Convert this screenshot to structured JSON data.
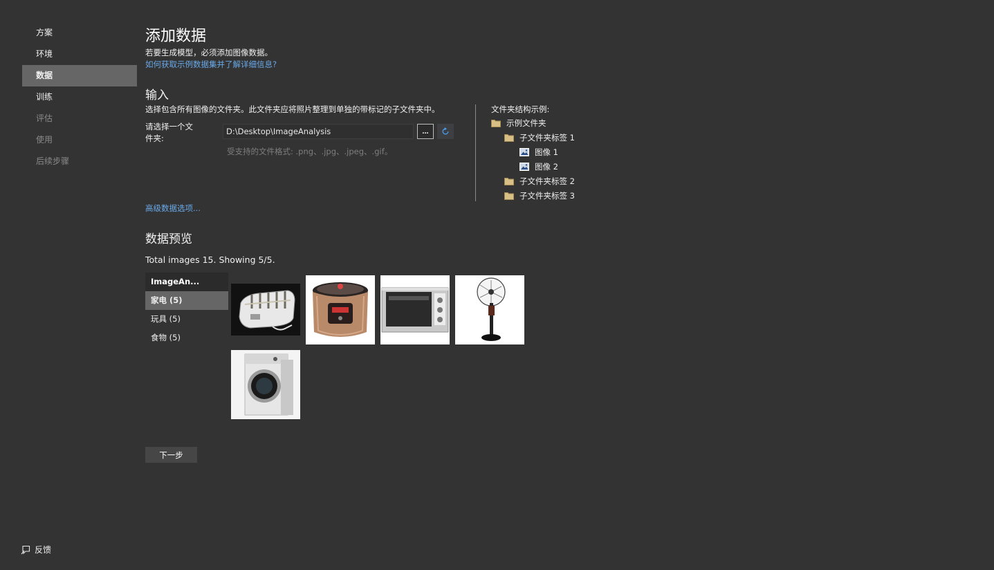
{
  "sidebar": {
    "items": [
      {
        "label": "方案",
        "state": "normal"
      },
      {
        "label": "环境",
        "state": "normal"
      },
      {
        "label": "数据",
        "state": "active"
      },
      {
        "label": "训练",
        "state": "normal"
      },
      {
        "label": "评估",
        "state": "disabled"
      },
      {
        "label": "使用",
        "state": "disabled"
      },
      {
        "label": "后续步骤",
        "state": "disabled"
      }
    ],
    "feedback_label": "反馈"
  },
  "header": {
    "title": "添加数据",
    "subtitle": "若要生成模型，必须添加图像数据。",
    "help_link": "如何获取示例数据集并了解详细信息?"
  },
  "input_section": {
    "title": "输入",
    "description": "选择包含所有图像的文件夹。此文件夹应将照片整理到单独的带标记的子文件夹中。",
    "folder_label_line1": "请选择一个文",
    "folder_label_line2": "件夹:",
    "folder_path": "D:\\Desktop\\ImageAnalysis",
    "browse_label": "...",
    "supported_formats": "受支持的文件格式: .png、.jpg、.jpeg、.gif。",
    "advanced_link": "高级数据选项..."
  },
  "folder_example": {
    "title": "文件夹结构示例:",
    "tree": [
      {
        "label": "示例文件夹",
        "type": "folder",
        "level": 0
      },
      {
        "label": "子文件夹标签 1",
        "type": "folder",
        "level": 1
      },
      {
        "label": "图像 1",
        "type": "image",
        "level": 2
      },
      {
        "label": "图像 2",
        "type": "image",
        "level": 2
      },
      {
        "label": "子文件夹标签 2",
        "type": "folder",
        "level": 1
      },
      {
        "label": "子文件夹标签 3",
        "type": "folder",
        "level": 1
      }
    ]
  },
  "preview": {
    "title": "数据预览",
    "summary": "Total images 15. Showing 5/5.",
    "categories": [
      {
        "label": "ImageAn...",
        "role": "header"
      },
      {
        "label": "家电 (5)",
        "role": "selected"
      },
      {
        "label": "玩具 (5)",
        "role": "normal"
      },
      {
        "label": "食物 (5)",
        "role": "normal"
      }
    ],
    "thumbnails": [
      {
        "icon": "toaster-image"
      },
      {
        "icon": "rice-cooker-image"
      },
      {
        "icon": "oven-image"
      },
      {
        "icon": "fan-image"
      },
      {
        "icon": "washing-machine-image"
      }
    ]
  },
  "footer": {
    "next_label": "下一步"
  },
  "colors": {
    "background": "#333333",
    "active_nav": "#666666",
    "link": "#6aa9e8",
    "folder": "#d8bf86"
  }
}
